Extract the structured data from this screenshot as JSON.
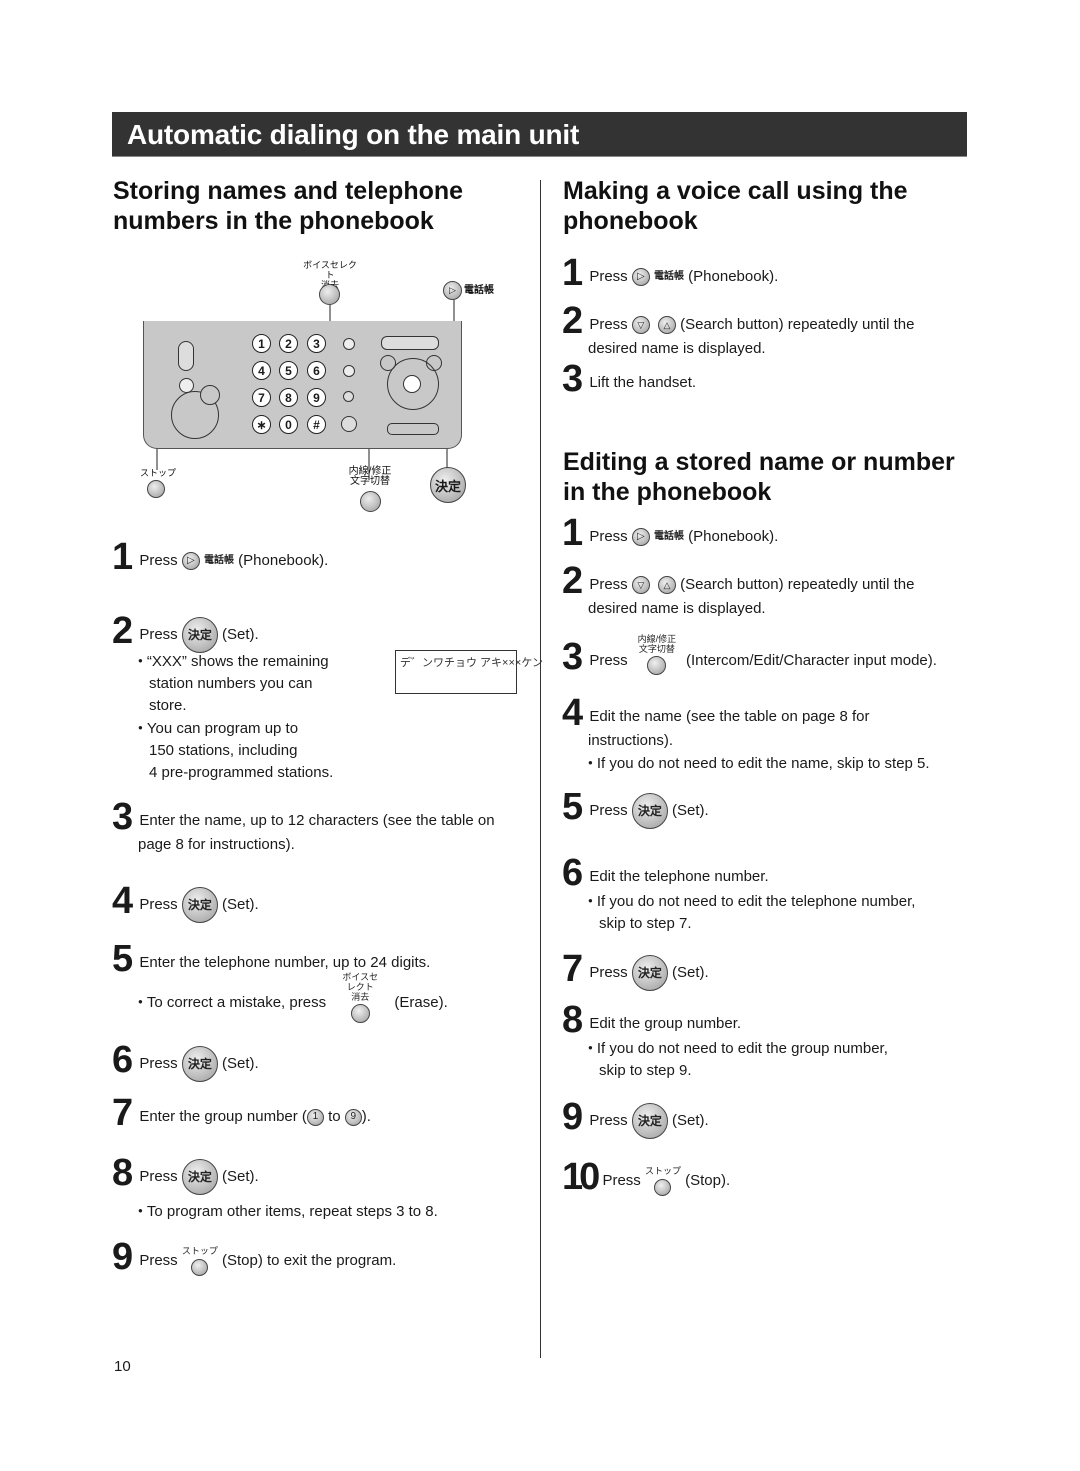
{
  "banner": {
    "title": "Automatic dialing on the main unit"
  },
  "left": {
    "heading": "Storing names and telephone numbers in the phonebook",
    "diagram": {
      "erase_label_top": "ボイスセレクト",
      "erase_label_bottom": "消去",
      "phonebook_label": "電話帳",
      "stop_label": "ストップ",
      "intercom_label_top": "内線/修正",
      "intercom_label_bottom": "文字切替",
      "set_label": "決定",
      "keys": [
        "1",
        "2",
        "3",
        "4",
        "5",
        "6",
        "7",
        "8",
        "9",
        "∗",
        "0",
        "#"
      ]
    },
    "lcd_text": "デ゛ンワチョウ アキ×××ケン",
    "steps": [
      {
        "num": "1",
        "pre": "Press",
        "button": "電話帳",
        "post": "(Phonebook)."
      },
      {
        "num": "2",
        "pre": "Press",
        "button": "決定",
        "post": "(Set).",
        "bullets": [
          "“XXX” shows the remaining station numbers you can store.",
          "You can program up to 150 stations, including 4 pre-programmed stations."
        ],
        "bullet_lines": [
          "“XXX” shows the remaining",
          "station numbers you can",
          "store.",
          "You can program up to",
          "150 stations, including",
          "4 pre-programmed stations."
        ]
      },
      {
        "num": "3",
        "text_line1": "Enter the name, up to 12 characters (see the table on",
        "text_line2": "page 8 for instructions)."
      },
      {
        "num": "4",
        "pre": "Press",
        "button": "決定",
        "post": "(Set)."
      },
      {
        "num": "5",
        "text": "Enter the telephone number, up to 24 digits.",
        "bullet_pre": "To correct a mistake, press",
        "bullet_button_top": "ボイスセレクト",
        "bullet_button_bottom": "消去",
        "bullet_post": "(Erase)."
      },
      {
        "num": "6",
        "pre": "Press",
        "button": "決定",
        "post": "(Set)."
      },
      {
        "num": "7",
        "pre": "Enter the group number (",
        "key_from": "1",
        "mid": "to",
        "key_to": "9",
        "post": ")."
      },
      {
        "num": "8",
        "pre": "Press",
        "button": "決定",
        "post": "(Set).",
        "bullet": "To program other items, repeat steps 3 to 8."
      },
      {
        "num": "9",
        "pre": "Press",
        "button_label": "ストップ",
        "post": "(Stop) to exit the program."
      }
    ]
  },
  "right": {
    "voice_call": {
      "heading_line1": "Making a voice call using the",
      "heading_line2": "phonebook",
      "steps": [
        {
          "num": "1",
          "pre": "Press",
          "button": "電話帳",
          "post": "(Phonebook)."
        },
        {
          "num": "2",
          "pre": "Press",
          "post": "(Search button) repeatedly until the",
          "line2": "desired name is displayed."
        },
        {
          "num": "3",
          "text": "Lift the handset."
        }
      ]
    },
    "editing": {
      "heading_line1": "Editing a stored name or number",
      "heading_line2": "in the phonebook",
      "steps": [
        {
          "num": "1",
          "pre": "Press",
          "button": "電話帳",
          "post": "(Phonebook)."
        },
        {
          "num": "2",
          "pre": "Press",
          "post": "(Search button) repeatedly until the",
          "line2": "desired name is displayed."
        },
        {
          "num": "3",
          "pre": "Press",
          "button_top": "内線/修正",
          "button_bottom": "文字切替",
          "post": "(Intercom/Edit/Character input mode)."
        },
        {
          "num": "4",
          "line1": "Edit the name (see the table on page 8 for",
          "line2": "instructions).",
          "bullet": "If you do not need to edit the name, skip to step 5."
        },
        {
          "num": "5",
          "pre": "Press",
          "button": "決定",
          "post": "(Set)."
        },
        {
          "num": "6",
          "text": "Edit the telephone number.",
          "bullet_line1": "If you do not need to edit the telephone number,",
          "bullet_line2": "skip to step 7."
        },
        {
          "num": "7",
          "pre": "Press",
          "button": "決定",
          "post": "(Set)."
        },
        {
          "num": "8",
          "text": "Edit the group number.",
          "bullet_line1": "If you do not need to edit the group number,",
          "bullet_line2": "skip to step 9."
        },
        {
          "num": "9",
          "pre": "Press",
          "button": "決定",
          "post": "(Set)."
        },
        {
          "num": "10",
          "pre": "Press",
          "button_label": "ストップ",
          "post": "(Stop)."
        }
      ]
    }
  },
  "footer": {
    "page_number": "10"
  }
}
